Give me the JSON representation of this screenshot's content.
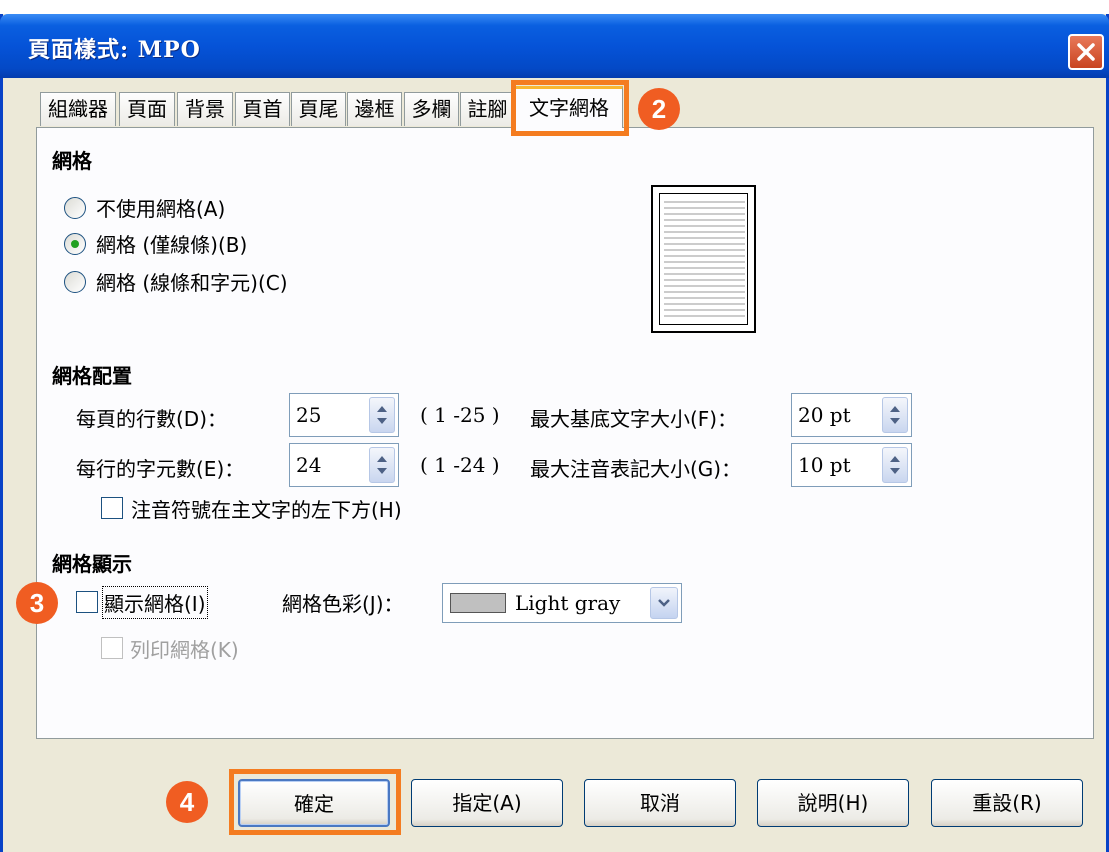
{
  "window": {
    "title": "頁面樣式: MPO"
  },
  "tabs": [
    {
      "label": "組織器"
    },
    {
      "label": "頁面"
    },
    {
      "label": "背景"
    },
    {
      "label": "頁首"
    },
    {
      "label": "頁尾"
    },
    {
      "label": "邊框"
    },
    {
      "label": "多欄"
    },
    {
      "label": "註腳"
    },
    {
      "label": "文字網格",
      "active": true
    }
  ],
  "grid": {
    "section_title": "網格",
    "options": [
      {
        "label": "不使用網格(A)",
        "selected": false
      },
      {
        "label": "網格 (僅線條)(B)",
        "selected": true
      },
      {
        "label": "網格 (線條和字元)(C)",
        "selected": false
      }
    ]
  },
  "layout": {
    "section_title": "網格配置",
    "lines_per_page": {
      "label": "每頁的行數(D)：",
      "value": "25",
      "range": "( 1 -25 )"
    },
    "chars_per_line": {
      "label": "每行的字元數(E)：",
      "value": "24",
      "range": "( 1 -24 )"
    },
    "max_base_text_size": {
      "label": "最大基底文字大小(F)：",
      "value": "20 pt"
    },
    "max_ruby_text_size": {
      "label": "最大注音表記大小(G)：",
      "value": "10 pt"
    },
    "ruby_below": {
      "label": "注音符號在主文字的左下方(H)",
      "checked": false
    }
  },
  "display": {
    "section_title": "網格顯示",
    "show_grid": {
      "label": "顯示網格(I)",
      "checked": false
    },
    "grid_color": {
      "label": "網格色彩(J)：",
      "value": "Light gray",
      "swatch": "#c0c0c0"
    },
    "print_grid": {
      "label": "列印網格(K)",
      "checked": false,
      "disabled": true
    }
  },
  "buttons": {
    "ok": "確定",
    "apply": "指定(A)",
    "cancel": "取消",
    "help": "說明(H)",
    "reset": "重設(R)"
  },
  "annotations": {
    "step2": "2",
    "step3": "3",
    "step4": "4"
  },
  "colors": {
    "highlight": "#f47c20",
    "badge": "#f05d22",
    "titlebar": "#0553d8"
  }
}
